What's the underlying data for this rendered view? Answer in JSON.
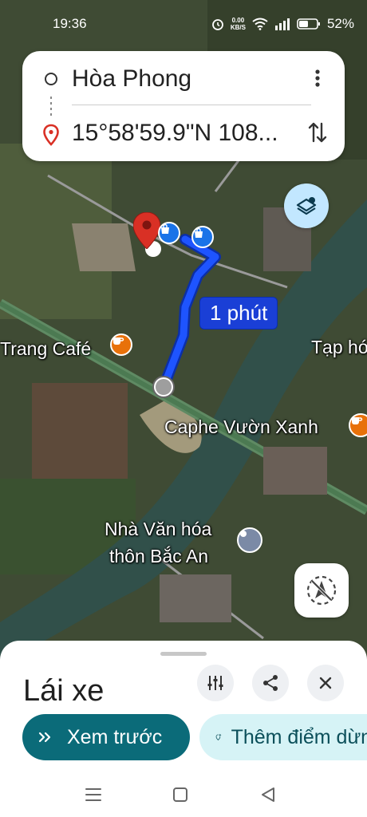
{
  "status_bar": {
    "time": "19:36",
    "net_speed_value": "0.00",
    "net_speed_unit": "KB/S",
    "battery": "52%"
  },
  "route": {
    "origin": "Hòa Phong",
    "destination": "15°58'59.9\"N 108...",
    "more_icon": "more-vert-icon",
    "swap_icon": "swap-vert-icon"
  },
  "map": {
    "eta_label": "1 phút",
    "labels": {
      "trang_cafe": "Trang Café",
      "tap_hoa": "Tạp hó",
      "caphe_vuon_xanh": "Caphe Vườn Xanh",
      "nha_van_hoa_line1": "Nhà Văn hóa",
      "nha_van_hoa_line2": "thôn Bắc An"
    },
    "colors": {
      "route": "#1a3fd6",
      "pin": "#d93025",
      "poi_shop": "#1a73e8",
      "poi_cafe": "#e8710a"
    }
  },
  "sheet": {
    "mode_title": "Lái xe",
    "preview_label": "Xem trước",
    "add_stop_label": "Thêm điểm dừng",
    "colors": {
      "preview_bg": "#0b6b79",
      "add_stop_bg": "#d6f3f6"
    }
  }
}
